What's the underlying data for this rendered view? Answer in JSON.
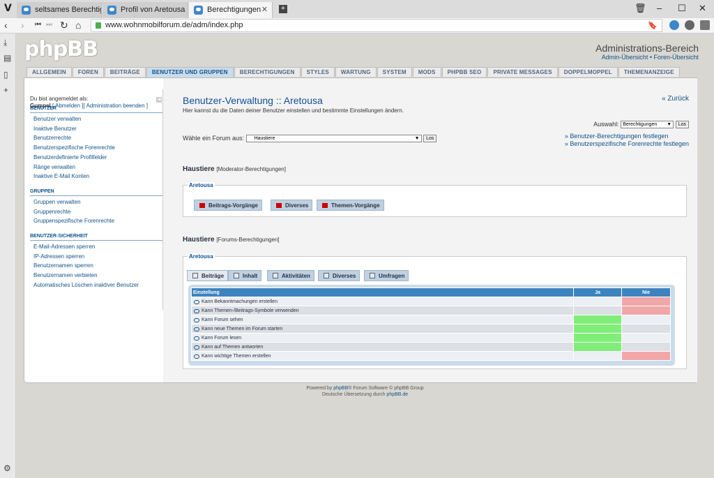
{
  "browser": {
    "tabs": [
      {
        "label": "seltsames Berechtigungsproble",
        "active": false
      },
      {
        "label": "Profil von Aretousa",
        "active": false
      },
      {
        "label": "Berechtigungen",
        "active": true
      }
    ],
    "url": "www.wohnmobilforum.de/adm/index.php"
  },
  "header": {
    "logo": "phpBB",
    "title": "Administrations-Bereich",
    "links": "Admin-Übersicht • Foren-Übersicht"
  },
  "main_tabs": [
    {
      "label": "ALLGEMEIN",
      "active": false
    },
    {
      "label": "FOREN",
      "active": false
    },
    {
      "label": "BEITRÄGE",
      "active": false
    },
    {
      "label": "BENUTZER UND GRUPPEN",
      "active": true
    },
    {
      "label": "BERECHTIGUNGEN",
      "active": false
    },
    {
      "label": "STYLES",
      "active": false
    },
    {
      "label": "WARTUNG",
      "active": false
    },
    {
      "label": "SYSTEM",
      "active": false
    },
    {
      "label": "MODS",
      "active": false
    },
    {
      "label": "PHPBB SEO",
      "active": false
    },
    {
      "label": "PRIVATE MESSAGES",
      "active": false
    },
    {
      "label": "DOPPELMOPPEL",
      "active": false
    },
    {
      "label": "THEMENANZEIGE",
      "active": false
    }
  ],
  "sidebar": {
    "login_line1": "Du bist angemeldet als:",
    "login_user": "Gumpel",
    "login_links": "[ Abmelden ][ Administration beenden ]",
    "sections": [
      {
        "title": "BENUTZER",
        "items": [
          "Benutzer verwalten",
          "Inaktive Benutzer",
          "Benutzerrechte",
          "Benutzerspezifische Forenrechte",
          "Benutzerdefinierte Profilfelder",
          "Ränge verwalten",
          "Inaktive E-Mail Konten"
        ]
      },
      {
        "title": "GRUPPEN",
        "items": [
          "Gruppen verwalten",
          "Gruppenrechte",
          "Gruppenspezifische Forenrechte"
        ]
      },
      {
        "title": "BENUTZER-SICHERHEIT",
        "items": [
          "E-Mail-Adressen sperren",
          "IP-Adressen sperren",
          "Benutzernamen sperren",
          "Benutzernamen verbieten",
          "Automatisches Löschen inaktiver Benutzer"
        ]
      }
    ]
  },
  "content": {
    "title": "Benutzer-Verwaltung :: Aretousa",
    "subtitle": "Hier kannst du die Daten deiner Benutzer einstellen und bestimmte Einstellungen ändern.",
    "back": "« Zurück",
    "auswahl_label": "Auswahl:",
    "auswahl_value": "Berechtigungen",
    "los": "Los",
    "right_links": [
      "» Benutzer-Berechtigungen festlegen",
      "» Benutzerspezifische Forenrechte festlegen"
    ],
    "forum_label": "Wähle ein Forum aus:",
    "forum_value": "Haustiere",
    "mod_heading_forum": "Haustiere",
    "mod_heading_type": "[Moderator-Berechtigungen]",
    "mod_legend": "Aretousa",
    "mod_tabs": [
      "Beitrags-Vorgänge",
      "Diverses",
      "Themen-Vorgänge"
    ],
    "forum_heading_forum": "Haustiere",
    "forum_heading_type": "[Forums-Berechtigungen]",
    "forum_legend": "Aretousa",
    "forum_tabs": [
      "Beiträge",
      "Inhalt",
      "Aktivitäten",
      "Diverses",
      "Umfragen"
    ],
    "table_headers": [
      "Einstellung",
      "Ja",
      "Nie"
    ],
    "rows": [
      {
        "label": "Kann Bekanntmachungen erstellen",
        "value": "Nie"
      },
      {
        "label": "Kann Themen-/Beitrags-Symbole verwenden",
        "value": "Nie"
      },
      {
        "label": "Kann Forum sehen",
        "value": "Ja"
      },
      {
        "label": "Kann neue Themen im Forum starten",
        "value": "Ja"
      },
      {
        "label": "Kann Forum lesen",
        "value": "Ja"
      },
      {
        "label": "Kann auf Themen antworten",
        "value": "Ja"
      },
      {
        "label": "Kann wichtige Themen erstellen",
        "value": "Nie"
      }
    ]
  },
  "footer": {
    "line1_pre": "Powered by ",
    "line1_link": "phpBB",
    "line1_post": "® Forum Software © phpBB Group",
    "line2_pre": "Deutsche Übersetzung durch ",
    "line2_link": "phpBB.de"
  }
}
